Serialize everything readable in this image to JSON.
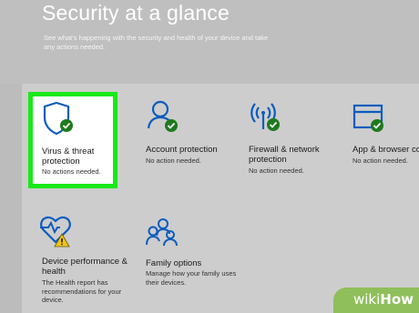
{
  "header": {
    "title": "Security at a glance",
    "subtitle": "See what's happening with the security and health of your device and take any actions needed."
  },
  "tiles": [
    {
      "label": "Virus & threat protection",
      "status": "No actions needed.",
      "icon": "shield-check-icon"
    },
    {
      "label": "Account protection",
      "status": "No action needed.",
      "icon": "person-check-icon"
    },
    {
      "label": "Firewall & network protection",
      "status": "No action needed.",
      "icon": "wifi-antenna-check-icon"
    },
    {
      "label": "App & browser co",
      "status": "No action needed.",
      "icon": "browser-window-check-icon"
    },
    {
      "label": "Device performance & health",
      "status": "The Health report has recommendations for your device.",
      "icon": "heart-pulse-warning-icon"
    },
    {
      "label": "Family options",
      "status": "Manage how your family uses their devices.",
      "icon": "family-icon"
    }
  ],
  "watermark": {
    "text": "wikiHow",
    "part1": "wiki",
    "part2": "How"
  },
  "colors": {
    "accent": "#0a5cbf",
    "ok": "#1e7a1e",
    "warning": "#f0c419",
    "highlight": "#19e919"
  }
}
